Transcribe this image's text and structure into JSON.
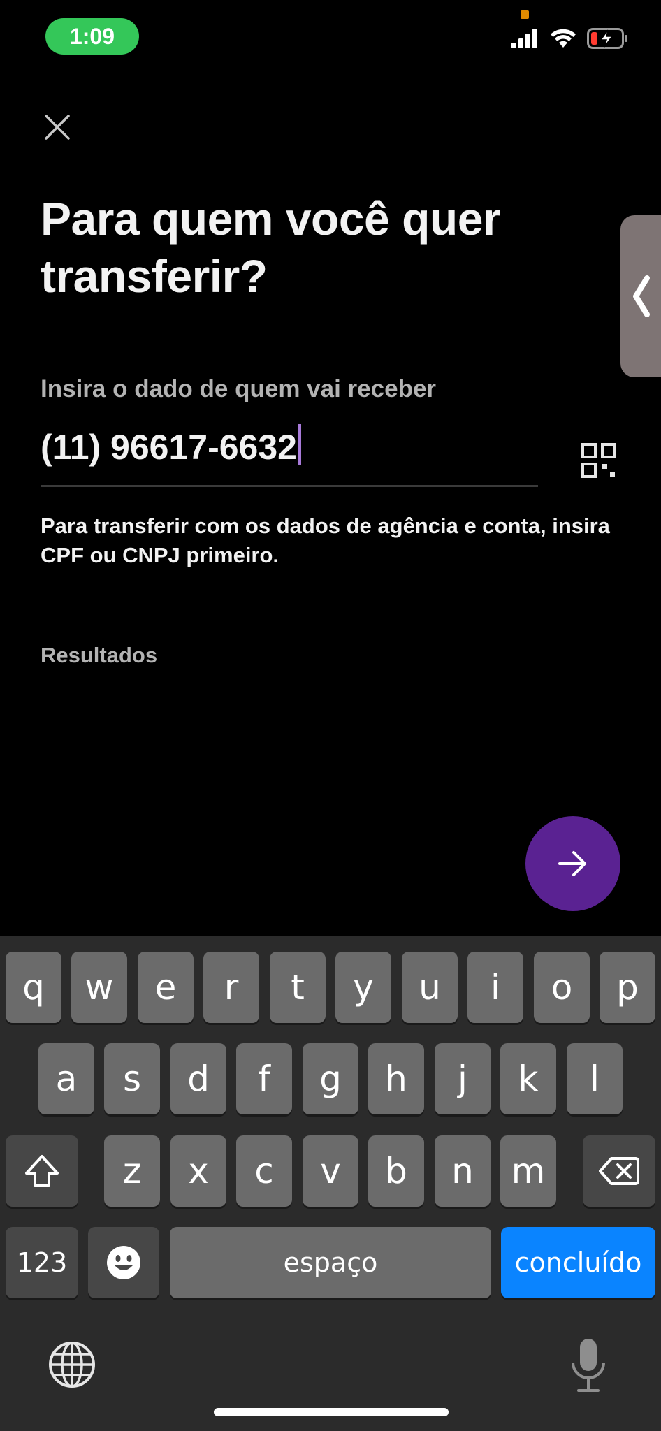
{
  "status_bar": {
    "time": "1:09",
    "accent": "#34c759"
  },
  "header": {
    "close_icon": "close-icon"
  },
  "title": "Para quem você quer transferir?",
  "field": {
    "label": "Insira o dado de quem vai receber",
    "value": "(11) 96617-6632",
    "qr_icon": "qr-code-icon"
  },
  "hint": "Para transferir com os dados de agência e conta, insira CPF ou CNPJ primeiro.",
  "results_label": "Resultados",
  "next_button": {
    "icon": "arrow-right-icon",
    "color": "#5a2292"
  },
  "keyboard": {
    "row1": [
      "q",
      "w",
      "e",
      "r",
      "t",
      "y",
      "u",
      "i",
      "o",
      "p"
    ],
    "row2": [
      "a",
      "s",
      "d",
      "f",
      "g",
      "h",
      "j",
      "k",
      "l"
    ],
    "row3": [
      "z",
      "x",
      "c",
      "v",
      "b",
      "n",
      "m"
    ],
    "numbers_key": "123",
    "space_key": "espaço",
    "done_key": "concluído",
    "done_color": "#0a84ff"
  }
}
